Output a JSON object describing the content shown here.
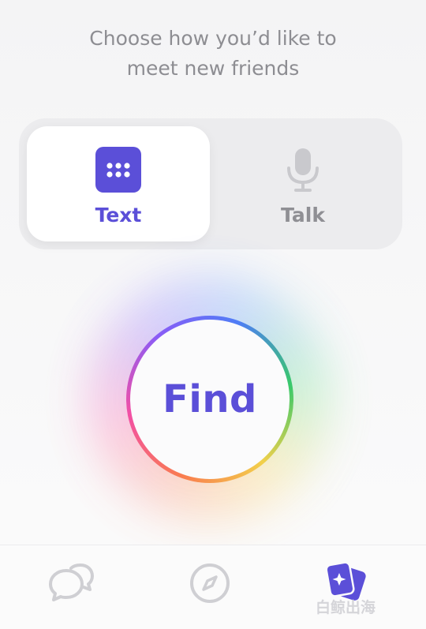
{
  "header": {
    "prompt_line1": "Choose how you’d like to",
    "prompt_line2": "meet new friends"
  },
  "mode_switch": {
    "options": [
      {
        "label": "Text",
        "icon": "keyboard-icon",
        "selected": true
      },
      {
        "label": "Talk",
        "icon": "microphone-icon",
        "selected": false
      }
    ]
  },
  "find_button": {
    "label": "Find"
  },
  "bottom_nav": {
    "items": [
      {
        "icon": "chat-bubbles-icon",
        "active": false
      },
      {
        "icon": "compass-icon",
        "active": false
      },
      {
        "icon": "sparkle-cards-icon",
        "active": true
      }
    ]
  },
  "watermark": {
    "text": "白鲸出海"
  },
  "colors": {
    "accent": "#5b4fd8",
    "inactive": "#8f8f94",
    "background": "#f6f6f7"
  }
}
